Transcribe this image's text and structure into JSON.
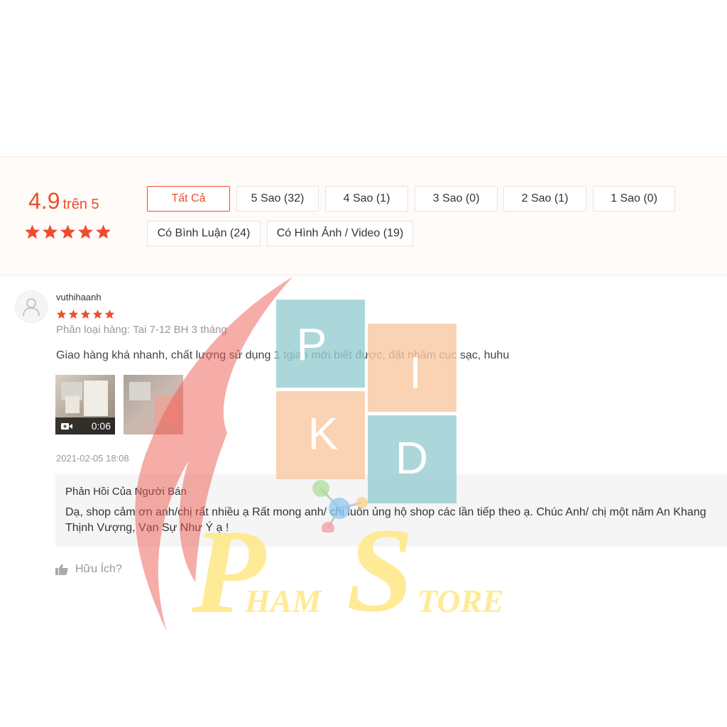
{
  "rating": {
    "score": "4.9",
    "suffix": "trên 5",
    "stars": 5,
    "color": "#ee4d2d"
  },
  "filters": [
    {
      "label": "Tất Cả",
      "active": true
    },
    {
      "label": "5 Sao (32)"
    },
    {
      "label": "4 Sao (1)"
    },
    {
      "label": "3 Sao (0)"
    },
    {
      "label": "2 Sao (1)"
    },
    {
      "label": "1 Sao (0)"
    },
    {
      "label": "Có Bình Luận (24)"
    },
    {
      "label": "Có Hình Ảnh / Video (19)"
    }
  ],
  "review": {
    "username": "vuthihaanh",
    "stars": 5,
    "variation": "Phân loại hàng: Tai 7-12 BH 3 tháng",
    "comment": "Giao hàng khá nhanh, chất lượng sử dụng 1 tgian mới biết được, đặt nhầm cục sạc, huhu",
    "video_duration": "0:06",
    "time": "2021-02-05 18:08",
    "seller_reply": {
      "title": "Phản Hồi Của Người Bán",
      "text": "Dạ, shop cảm ơn anh/chị rất nhiều ạ Rất mong anh/ chị luôn ủng hộ shop các lần tiếp theo ạ. Chúc Anh/ chị một năm An Khang Thịnh Vượng, Vạn Sự Như Ý ạ !"
    },
    "helpful_label": "Hữu Ích?"
  },
  "watermark": {
    "logo_letters": [
      "P",
      "I",
      "K",
      "D"
    ],
    "brand_initial_1": "P",
    "brand_rest_1": "HAM",
    "brand_initial_2": "S",
    "brand_rest_2": "TORE"
  }
}
